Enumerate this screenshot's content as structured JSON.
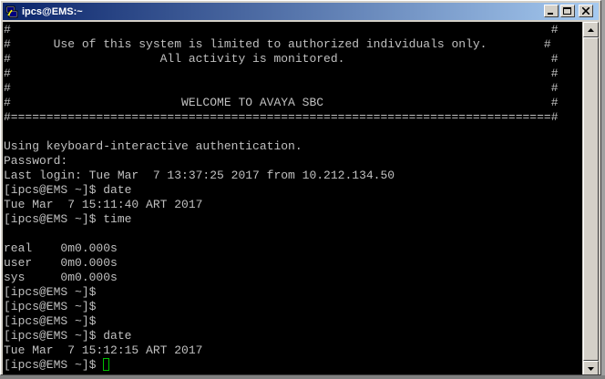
{
  "window": {
    "title": "ipcs@EMS:~",
    "icon": "putty-terminal-icon",
    "buttons": {
      "minimize": "minimize-icon",
      "maximize": "maximize-icon",
      "close": "close-icon"
    }
  },
  "terminal": {
    "cursor_color": "#00c000",
    "lines": [
      "#                                                                            #",
      "#      Use of this system is limited to authorized individuals only.        #",
      "#                     All activity is monitored.                             #",
      "#                                                                            #",
      "#                                                                            #",
      "#                        WELCOME TO AVAYA SBC                                #",
      "#============================================================================#",
      "",
      "Using keyboard-interactive authentication.",
      "Password:",
      "Last login: Tue Mar  7 13:37:25 2017 from 10.212.134.50",
      "[ipcs@EMS ~]$ date",
      "Tue Mar  7 15:11:40 ART 2017",
      "[ipcs@EMS ~]$ time",
      "",
      "real    0m0.000s",
      "user    0m0.000s",
      "sys     0m0.000s",
      "[ipcs@EMS ~]$",
      "[ipcs@EMS ~]$",
      "[ipcs@EMS ~]$",
      "[ipcs@EMS ~]$ date",
      "Tue Mar  7 15:12:15 ART 2017",
      "[ipcs@EMS ~]$ "
    ]
  }
}
